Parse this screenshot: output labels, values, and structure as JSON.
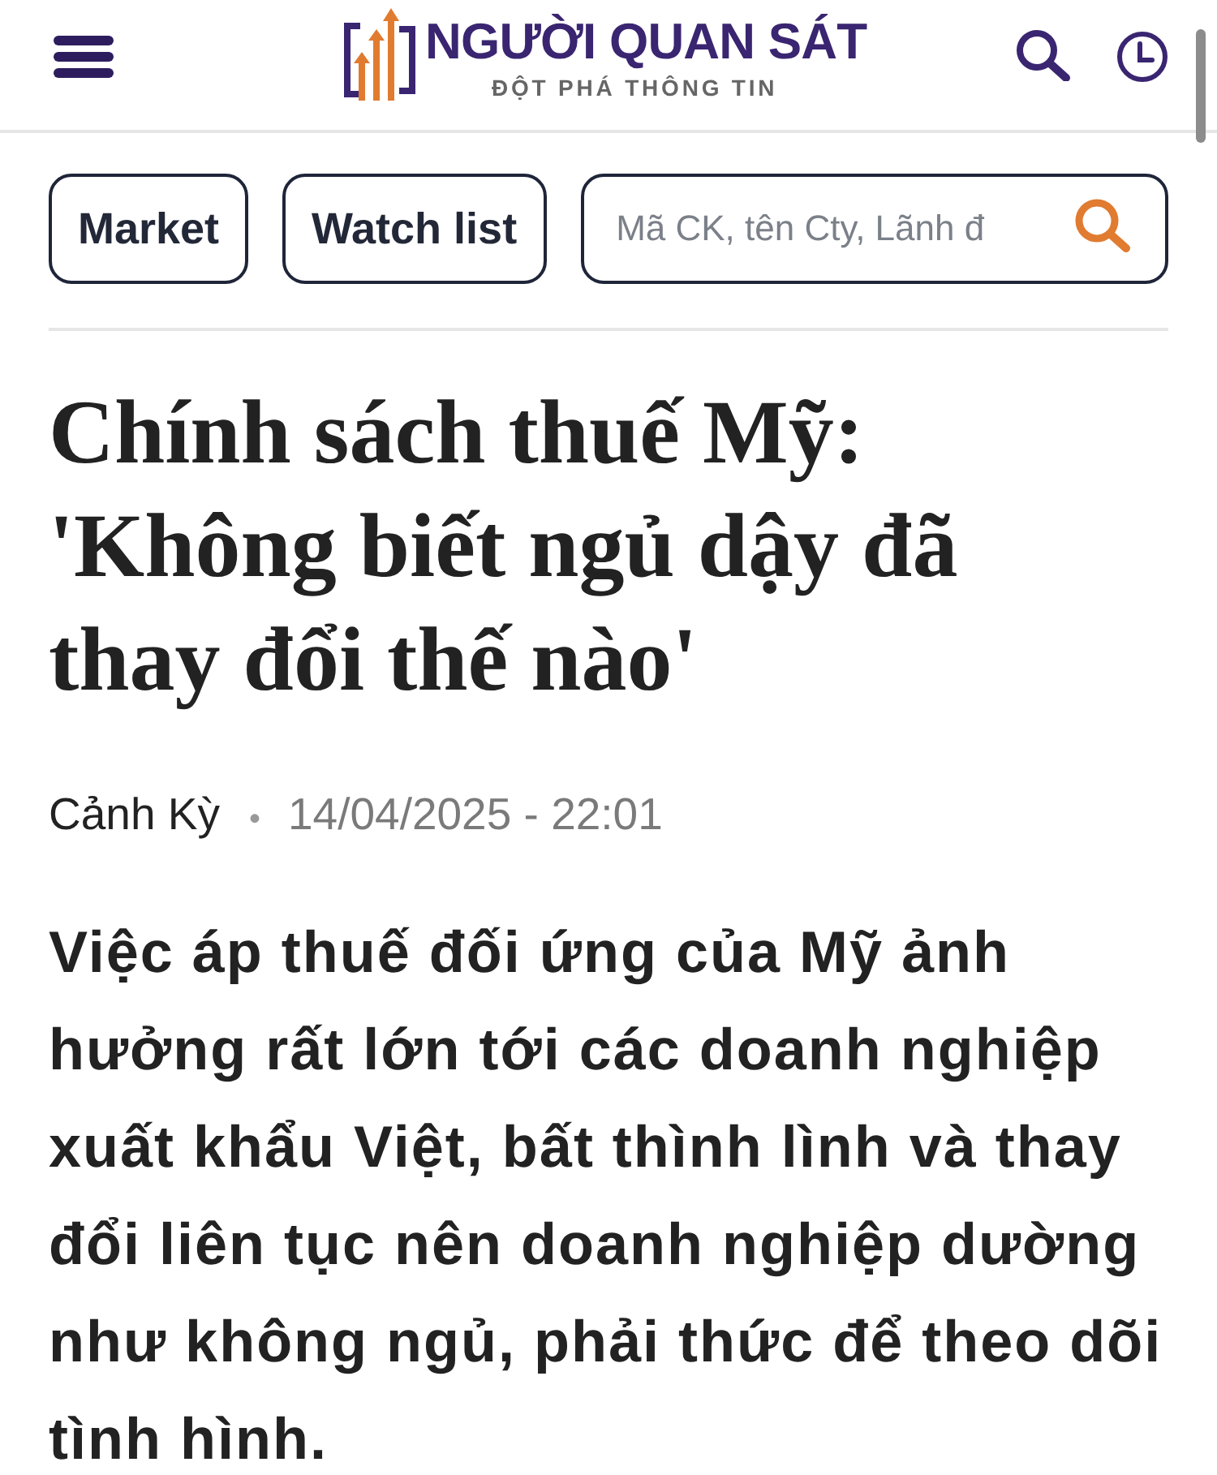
{
  "header": {
    "logo": {
      "name": "NGƯỜI QUAN SÁT",
      "tagline": "ĐỘT PHÁ THÔNG TIN"
    }
  },
  "toolbar": {
    "buttons": [
      "Market",
      "Watch list"
    ],
    "search": {
      "placeholder": "Mã CK, tên Cty, Lãnh đ"
    }
  },
  "article": {
    "title": "Chính sách thuế Mỹ: 'Không biết ngủ dậy đã thay đổi thế nào'",
    "author": "Cảnh Kỳ",
    "separator": "•",
    "date": "14/04/2025 - 22:01",
    "lead": "Việc áp thuế đối ứng của Mỹ ảnh hưởng rất lớn tới các doanh nghiệp xuất khẩu Việt, bất thình lình và thay đổi liên tục nên doanh nghiệp dường như không ngủ, phải thức để theo dõi tình hình."
  }
}
